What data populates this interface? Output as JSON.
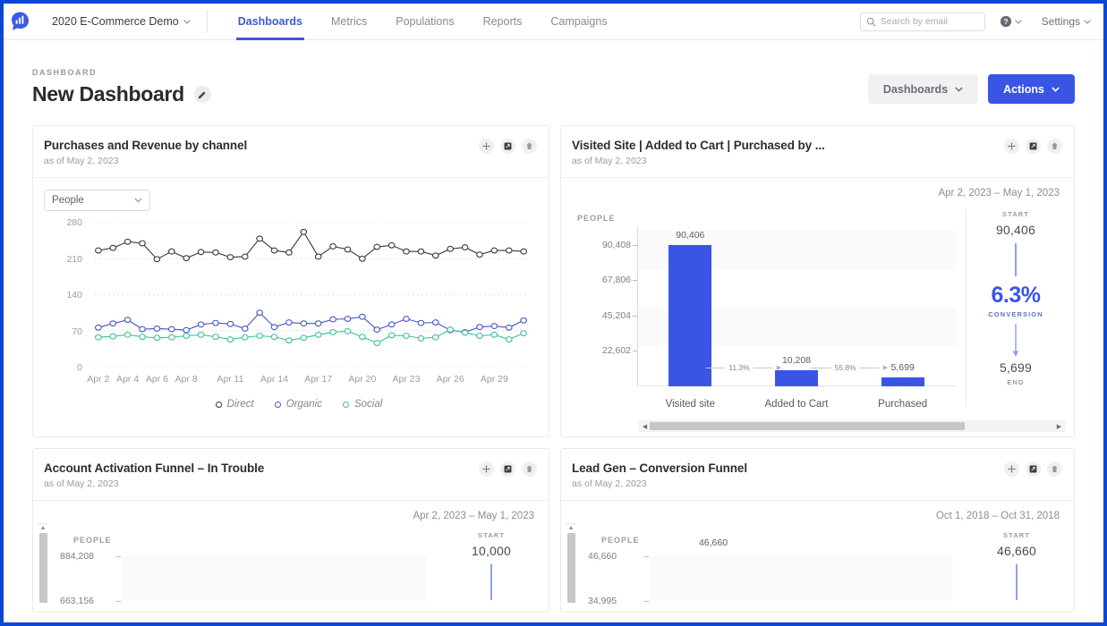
{
  "topnav": {
    "logo_icon": "analytics-logo-icon",
    "project_name": "2020 E-Commerce Demo",
    "tabs": [
      {
        "label": "Dashboards",
        "active": true
      },
      {
        "label": "Metrics",
        "active": false
      },
      {
        "label": "Populations",
        "active": false
      },
      {
        "label": "Reports",
        "active": false
      },
      {
        "label": "Campaigns",
        "active": false
      }
    ],
    "search": {
      "placeholder": "Search by email",
      "value": "",
      "icon": "search-icon"
    },
    "help_icon": "help-circle-icon",
    "settings_label": "Settings",
    "caret": "⌄"
  },
  "header": {
    "eyebrow": "DASHBOARD",
    "title": "New Dashboard",
    "edit_icon": "pencil-icon",
    "dashboards_button": "Dashboards",
    "actions_button": "Actions"
  },
  "card_icons": {
    "move": "move-icon",
    "expand": "expand-icon",
    "delete": "trash-icon"
  },
  "cards": [
    {
      "title": "Purchases and Revenue by channel",
      "subtitle": "as of May 2, 2023",
      "select_value": "People"
    },
    {
      "title": "Visited Site | Added to Cart | Purchased by ...",
      "subtitle": "as of May 2, 2023",
      "date_range": "Apr 2, 2023 – May 1, 2023"
    },
    {
      "title": "Account Activation Funnel – In Trouble",
      "subtitle": "as of May 2, 2023",
      "date_range": "Apr 2, 2023 – May 1, 2023"
    },
    {
      "title": "Lead Gen – Conversion Funnel",
      "subtitle": "as of May 2, 2023",
      "date_range": "Oct 1, 2018 – Oct 31, 2018"
    }
  ],
  "chart_data": [
    {
      "type": "line",
      "title": "Purchases and Revenue by channel",
      "xlabel": "",
      "ylabel": "People",
      "ylim": [
        0,
        280
      ],
      "yticks": [
        280,
        210,
        140,
        70,
        0
      ],
      "grid": true,
      "legend": [
        "Direct",
        "Organic",
        "Social"
      ],
      "legend_position": "bottom",
      "colors": {
        "Direct": "#363648",
        "Organic": "#4455c4",
        "Social": "#3bbfa0"
      },
      "xtick_labels": [
        "Apr 2",
        "Apr 4",
        "Apr 6",
        "Apr 8",
        "Apr 11",
        "Apr 14",
        "Apr 17",
        "Apr 20",
        "Apr 23",
        "Apr 26",
        "Apr 29"
      ],
      "x": [
        "Apr 2",
        "Apr 3",
        "Apr 4",
        "Apr 5",
        "Apr 6",
        "Apr 7",
        "Apr 8",
        "Apr 9",
        "Apr 10",
        "Apr 11",
        "Apr 12",
        "Apr 13",
        "Apr 14",
        "Apr 15",
        "Apr 16",
        "Apr 17",
        "Apr 18",
        "Apr 19",
        "Apr 20",
        "Apr 21",
        "Apr 22",
        "Apr 23",
        "Apr 24",
        "Apr 25",
        "Apr 26",
        "Apr 27",
        "Apr 28",
        "Apr 29",
        "Apr 30",
        "May 1"
      ],
      "series": [
        {
          "name": "Direct",
          "values": [
            226,
            231,
            243,
            240,
            209,
            224,
            211,
            223,
            222,
            213,
            214,
            249,
            226,
            222,
            262,
            214,
            234,
            228,
            210,
            233,
            236,
            224,
            224,
            216,
            229,
            232,
            218,
            226,
            226,
            224
          ]
        },
        {
          "name": "Organic",
          "values": [
            76,
            84,
            91,
            73,
            74,
            73,
            71,
            82,
            85,
            83,
            74,
            105,
            77,
            86,
            84,
            84,
            92,
            93,
            97,
            72,
            82,
            93,
            85,
            86,
            71,
            67,
            77,
            79,
            76,
            90
          ]
        },
        {
          "name": "Social",
          "values": [
            57,
            59,
            62,
            58,
            56,
            57,
            60,
            62,
            58,
            53,
            57,
            60,
            58,
            51,
            56,
            62,
            67,
            69,
            58,
            46,
            61,
            60,
            55,
            57,
            72,
            66,
            60,
            62,
            53,
            65
          ]
        }
      ]
    },
    {
      "type": "bar",
      "subtype": "funnel",
      "title": "Visited Site | Added to Cart | Purchased by ...",
      "ylabel": "PEOPLE",
      "categories": [
        "Visited site",
        "Added to Cart",
        "Purchased"
      ],
      "values": [
        90406,
        10208,
        5699
      ],
      "value_labels": [
        "90,406",
        "10,208",
        "5,699"
      ],
      "yticks": [
        90408,
        67806,
        45204,
        22602
      ],
      "ytick_labels": [
        "90,408",
        "67,806",
        "45,204",
        "22,602"
      ],
      "ylim": [
        0,
        100453
      ],
      "step_percents": [
        "11.3%",
        "55.8%"
      ],
      "bar_color": "#3a55e6",
      "summary": {
        "start_label": "START",
        "start_value": "90,406",
        "conversion_value": "6.3%",
        "conversion_label": "CONVERSION",
        "end_value": "5,699",
        "end_label": "END"
      }
    },
    {
      "type": "bar",
      "subtype": "funnel",
      "title": "Account Activation Funnel – In Trouble",
      "ylabel": "PEOPLE",
      "yticks": [
        884208,
        663156
      ],
      "ytick_labels": [
        "884,208",
        "663,156"
      ],
      "categories": [],
      "values": [],
      "summary": {
        "start_label": "START",
        "start_value": "10,000"
      }
    },
    {
      "type": "bar",
      "subtype": "funnel",
      "title": "Lead Gen – Conversion Funnel",
      "ylabel": "PEOPLE",
      "yticks": [
        46660,
        34995
      ],
      "ytick_labels": [
        "46,660",
        "34,995"
      ],
      "categories": [],
      "values": [
        46660
      ],
      "value_labels": [
        "46,660"
      ],
      "bar_color": "#3a55e6",
      "summary": {
        "start_label": "START",
        "start_value": "46,660"
      }
    }
  ],
  "scrollbars": {
    "left_arrow": "◀",
    "right_arrow": "▶",
    "up_arrow": "▲"
  }
}
